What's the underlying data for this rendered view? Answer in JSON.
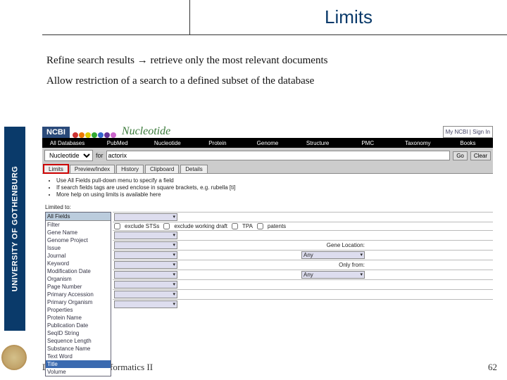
{
  "title": "Limits",
  "body": {
    "line1_a": "Refine search results ",
    "line1_arrow": "→",
    "line1_b": " retrieve only the most relevant documents",
    "line2": "Allow restriction of a search to a defined subset of the database"
  },
  "sidebar": {
    "university": "UNIVERSITY OF GOTHENBURG"
  },
  "ncbi": {
    "logo": "NCBI",
    "product": "Nucleotide",
    "login_text": "My NCBI | Sign In",
    "topnav": [
      "All Databases",
      "PubMed",
      "Nucleotide",
      "Protein",
      "Genome",
      "Structure",
      "PMC",
      "Taxonomy",
      "Books"
    ],
    "search_label": "Nucleotide",
    "for_label": "for",
    "query": "actorix",
    "go": "Go",
    "clear": "Clear",
    "tabs": [
      "Limits",
      "Preview/Index",
      "History",
      "Clipboard",
      "Details"
    ],
    "help": [
      "Use All Fields pull-down menu to specify a field",
      "If search fields tags are used enclose in square brackets, e.g. rubella [ti]",
      "More help on using limits is available here"
    ],
    "limited_to": "Limited to:",
    "dropdown": {
      "header": "All Fields",
      "options": [
        "Filter",
        "Gene Name",
        "Genome Project",
        "Issue",
        "Journal",
        "Keyword",
        "Modification Date",
        "Organism",
        "Page Number",
        "Primary Accession",
        "Primary Organism",
        "Properties",
        "Protein Name",
        "Publication Date",
        "SeqID String",
        "Sequence Length",
        "Substance Name",
        "Text Word",
        "Title",
        "Volume"
      ],
      "highlight_index": 18
    },
    "checkboxes": [
      "exclude STSs",
      "exclude working draft",
      "TPA",
      "patents"
    ],
    "row_labels": {
      "gene_location": "Gene Location:",
      "only_from": "Only from:",
      "any": "Any"
    }
  },
  "footer": {
    "left": "Databases in bioinformatics II",
    "page": "62"
  }
}
